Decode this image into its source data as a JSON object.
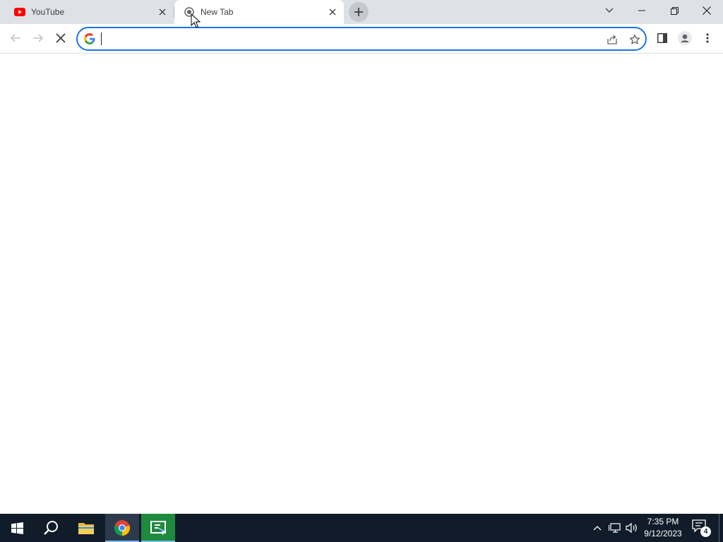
{
  "browser": {
    "tabs": [
      {
        "title": "YouTube",
        "icon": "youtube-icon",
        "active": false
      },
      {
        "title": "New Tab",
        "icon": "loading-globe-icon",
        "active": true
      }
    ],
    "window_controls": [
      "tab-search",
      "minimize",
      "restore",
      "close"
    ]
  },
  "toolbar": {
    "back_icon": "arrow-left-icon",
    "forward_icon": "arrow-right-icon",
    "stop_icon": "stop-loading-icon",
    "omnibox": {
      "value": "",
      "placeholder": ""
    },
    "omnibox_icons": [
      "share-icon",
      "star-icon"
    ],
    "right_icons": [
      "side-panel-icon",
      "profile-icon",
      "menu-icon"
    ]
  },
  "colors": {
    "tabstrip_bg": "#dee1e6",
    "focus_ring": "#1a73e8",
    "taskbar_bg": "#101c2a",
    "youtube_red": "#ff0000"
  },
  "taskbar": {
    "apps": [
      "start-icon",
      "search-icon",
      "file-explorer-icon",
      "chrome-icon",
      "remote-app-icon"
    ],
    "clock": {
      "time": "7:35 PM",
      "date": "9/12/2023"
    },
    "notification_count": "4"
  }
}
